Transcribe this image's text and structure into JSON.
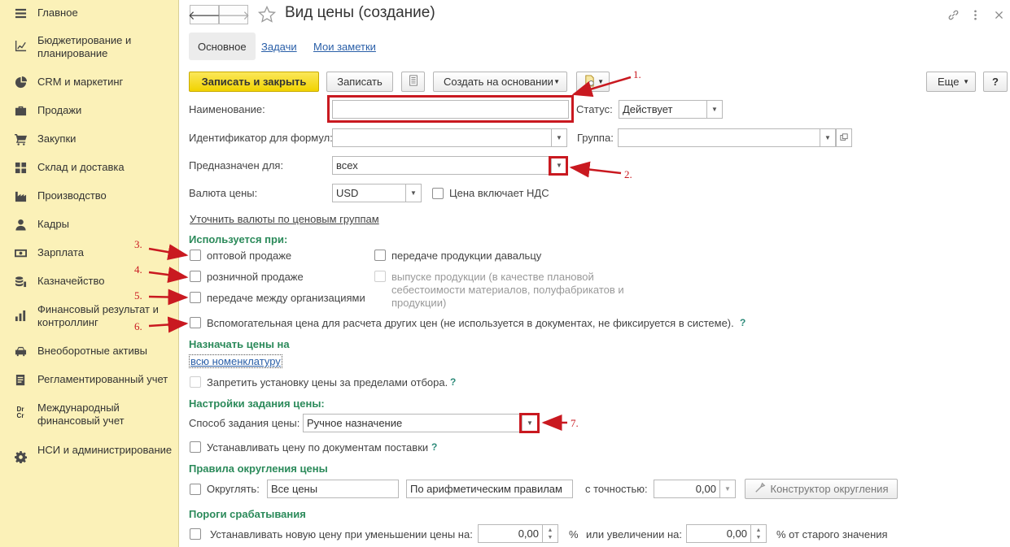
{
  "sidebar": {
    "items": [
      {
        "label": "Главное",
        "icon": "menu-icon"
      },
      {
        "label": "Бюджетирование и планирование",
        "icon": "chart-icon"
      },
      {
        "label": "CRM и маркетинг",
        "icon": "pie-chart-icon"
      },
      {
        "label": "Продажи",
        "icon": "briefcase-icon"
      },
      {
        "label": "Закупки",
        "icon": "cart-icon"
      },
      {
        "label": "Склад и доставка",
        "icon": "grid-icon"
      },
      {
        "label": "Производство",
        "icon": "factory-icon"
      },
      {
        "label": "Кадры",
        "icon": "person-icon"
      },
      {
        "label": "Зарплата",
        "icon": "money-icon"
      },
      {
        "label": "Казначейство",
        "icon": "coins-icon"
      },
      {
        "label": "Финансовый результат и контроллинг",
        "icon": "bar-chart-icon"
      },
      {
        "label": "Внеоборотные активы",
        "icon": "car-icon"
      },
      {
        "label": "Регламентированный учет",
        "icon": "book-icon"
      },
      {
        "label": "Международный финансовый учет",
        "icon": "dr-cr-icon",
        "icon_text": "Dr\nCr"
      },
      {
        "label": "НСИ и администрирование",
        "icon": "gear-icon"
      }
    ]
  },
  "header": {
    "title": "Вид цены (создание)",
    "back_glyph": "🡐",
    "forward_glyph": "🡒"
  },
  "tabs": [
    {
      "label": "Основное",
      "active": true
    },
    {
      "label": "Задачи",
      "active": false
    },
    {
      "label": "Мои заметки",
      "active": false
    }
  ],
  "toolbar": {
    "save_close": "Записать и закрыть",
    "save": "Записать",
    "create_based": "Создать на основании",
    "more": "Еще",
    "help": "?"
  },
  "form": {
    "name_label": "Наименование:",
    "name_value": "",
    "status_label": "Статус:",
    "status_value": "Действует",
    "formula_id_label": "Идентификатор для формул:",
    "formula_id_value": "",
    "group_label": "Группа:",
    "group_value": "",
    "intended_label": "Предназначен для:",
    "intended_value": "всех",
    "currency_label": "Валюта цены:",
    "currency_value": "USD",
    "vat_label": "Цена включает НДС",
    "currency_link": "Уточнить валюты по ценовым группам"
  },
  "usage": {
    "title": "Используется при:",
    "wholesale": "оптовой продаже",
    "retail": "розничной продаже",
    "transfer_orgs": "передаче между организациями",
    "transfer_contractor": "передаче продукции давальцу",
    "production_output": "выпуске продукции (в качестве плановой себестоимости материалов, полуфабрикатов и продукции)",
    "auxiliary": "Вспомогательная цена для расчета других цен (не используется в документах, не фиксируется в системе).",
    "help": "?"
  },
  "assign": {
    "title": "Назначать цены на",
    "all_link": "всю номенклатуру",
    "forbid": "Запретить установку цены за пределами отбора.",
    "help": "?"
  },
  "price_settings": {
    "title": "Настройки задания цены:",
    "method_label": "Способ задания цены:",
    "method_value": "Ручное назначение",
    "by_receipts": "Устанавливать цену по документам поставки",
    "help": "?"
  },
  "rounding": {
    "title": "Правила округления цены",
    "round_label": "Округлять:",
    "scope_value": "Все цены",
    "rule_value": "По арифметическим правилам",
    "precision_label": "с точностью:",
    "precision_value": "0,00",
    "constructor": "Конструктор округления"
  },
  "thresholds": {
    "title": "Пороги срабатывания",
    "decrease_label": "Устанавливать новую цену при уменьшении цены на:",
    "decrease_value": "0,00",
    "percent1": "%",
    "increase_label": "или увеличении на:",
    "increase_value": "0,00",
    "percent2": "% от старого значения"
  },
  "annotations": [
    "1.",
    "2.",
    "3.",
    "4.",
    "5.",
    "6.",
    "7."
  ],
  "colors": {
    "sidebar_bg": "#fbf1b8",
    "primary_button": "#f4d80a",
    "section_title": "#2b8a5a",
    "annotation_red": "#c91920",
    "link": "#2a5fa8"
  }
}
